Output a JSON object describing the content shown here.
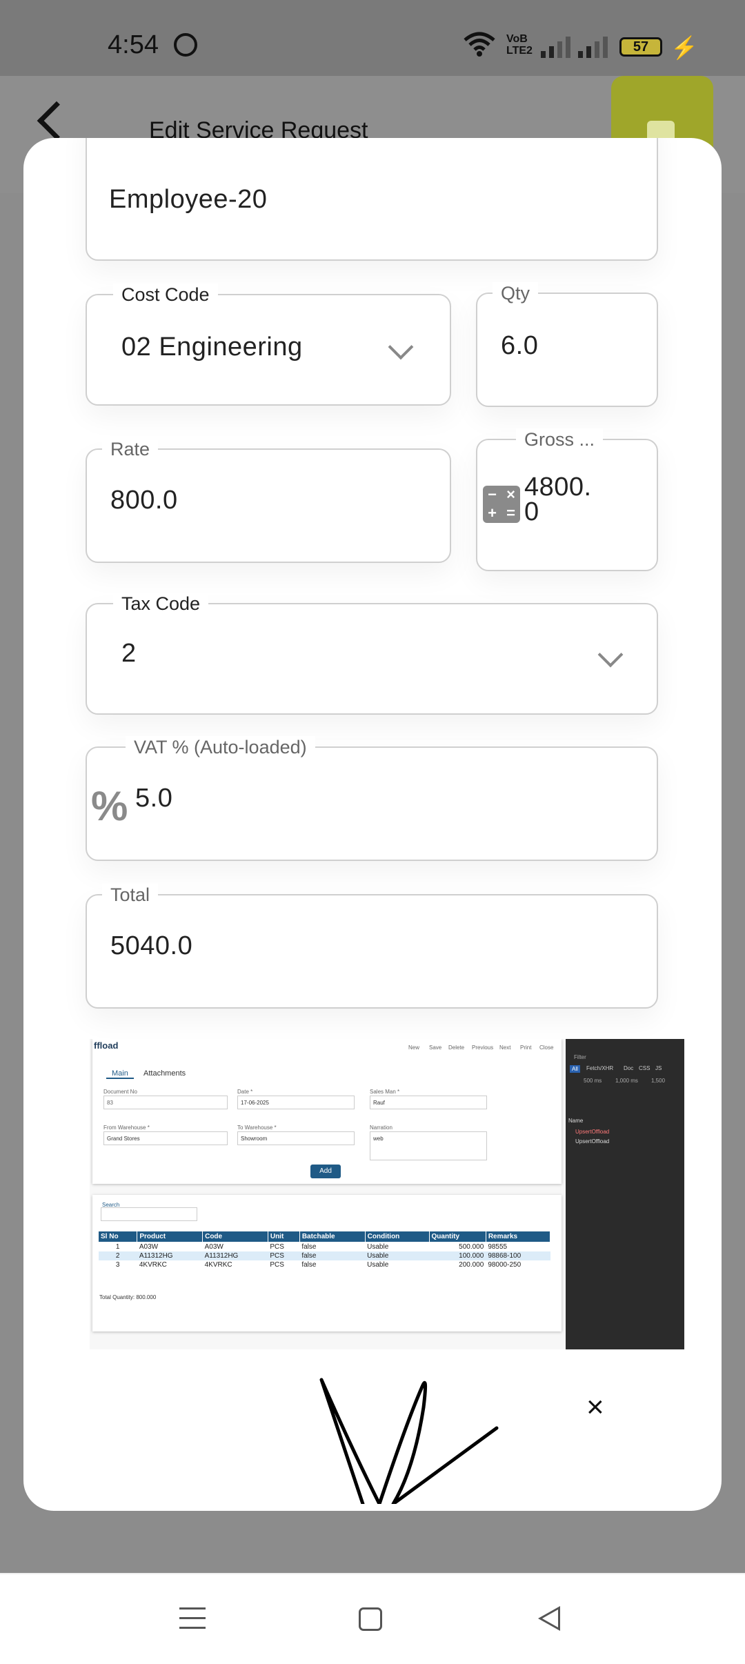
{
  "status_bar": {
    "time": "4:54",
    "battery": "57",
    "volte": [
      "VoB",
      "LTE2"
    ]
  },
  "app_bar": {
    "title": "Edit Service Request"
  },
  "form": {
    "employee": {
      "value": "Employee-20"
    },
    "cost_code": {
      "label": "Cost Code",
      "value": "02 Engineering"
    },
    "qty": {
      "label": "Qty",
      "value": "6.0"
    },
    "rate": {
      "label": "Rate",
      "value": "800.0"
    },
    "gross": {
      "label": "Gross ...",
      "value_line1": "4800.",
      "value_line2": "0"
    },
    "tax_code": {
      "label": "Tax Code",
      "value": "2"
    },
    "vat": {
      "label": "VAT % (Auto-loaded)",
      "value": "5.0"
    },
    "total": {
      "label": "Total",
      "value": "5040.0"
    }
  },
  "attachment_preview": {
    "title": "ffload",
    "toolbar": [
      "New",
      "Save",
      "Delete",
      "Previous",
      "Next",
      "Print",
      "Close"
    ],
    "tabs": [
      "Main",
      "Attachments"
    ],
    "fields": {
      "document_no": {
        "label": "Document No",
        "value": "83"
      },
      "date": {
        "label": "Date *",
        "value": "17-06-2025"
      },
      "sales_man": {
        "label": "Sales Man *",
        "value": "Rauf"
      },
      "from_warehouse": {
        "label": "From Warehouse *",
        "value": "Grand Stores"
      },
      "to_warehouse": {
        "label": "To Warehouse *",
        "value": "Showroom"
      },
      "narration": {
        "label": "Narration",
        "value": "web"
      }
    },
    "add_label": "Add",
    "search_label": "Search",
    "table": {
      "columns": [
        "Sl No",
        "Product",
        "Code",
        "Unit",
        "Batchable",
        "Condition",
        "Quantity",
        "Remarks"
      ],
      "rows": [
        [
          "1",
          "A03W",
          "A03W",
          "PCS",
          "false",
          "Usable",
          "500.000",
          "98555"
        ],
        [
          "2",
          "A11312HG",
          "A11312HG",
          "PCS",
          "false",
          "Usable",
          "100.000",
          "98868-100"
        ],
        [
          "3",
          "4KVRKC",
          "4KVRKC",
          "PCS",
          "false",
          "Usable",
          "200.000",
          "98000-250"
        ]
      ]
    },
    "total_quantity": "Total Quantity: 800.000",
    "devtools": {
      "filter": "Filter",
      "filter_tabs": [
        "All",
        "Fetch/XHR",
        "Doc",
        "CSS",
        "JS"
      ],
      "timings": [
        "500 ms",
        "1,000 ms",
        "1,500"
      ],
      "name_header": "Name",
      "requests": [
        "UpsertOffload",
        "UpsertOffload"
      ]
    }
  },
  "signature": {
    "close_symbol": "×"
  }
}
